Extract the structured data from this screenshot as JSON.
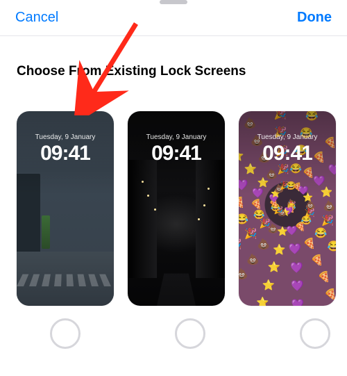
{
  "nav": {
    "cancel_label": "Cancel",
    "done_label": "Done"
  },
  "section": {
    "title": "Choose From Existing Lock Screens"
  },
  "lockscreens": [
    {
      "date": "Tuesday, 9 January",
      "time": "09:41"
    },
    {
      "date": "Tuesday, 9 January",
      "time": "09:41"
    },
    {
      "date": "Tuesday, 9 January",
      "time": "09:41"
    }
  ],
  "annotation": {
    "arrow_points_to_card": 0,
    "arrow_color": "#ff2a1a"
  }
}
